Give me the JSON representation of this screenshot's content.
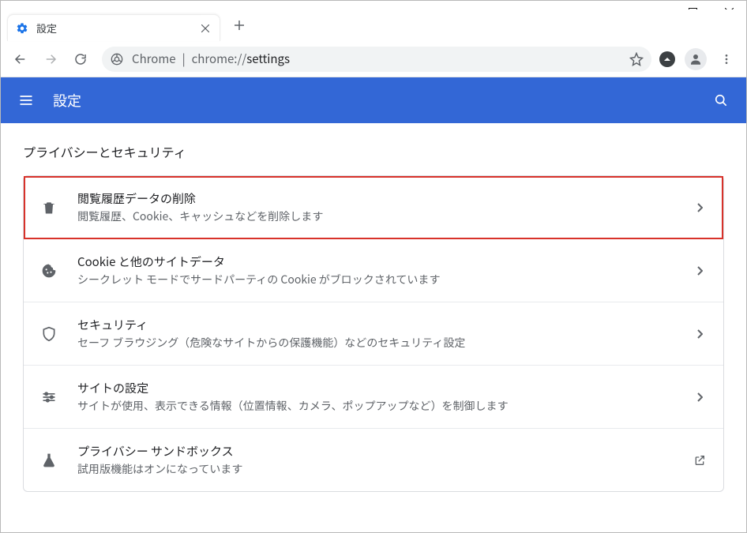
{
  "window": {
    "tab_title": "設定"
  },
  "omnibox": {
    "scheme_label": "Chrome",
    "sep": "|",
    "host": "chrome://",
    "path": "settings"
  },
  "header": {
    "title": "設定"
  },
  "section": {
    "title": "プライバシーとセキュリティ"
  },
  "rows": [
    {
      "title": "閲覧履歴データの削除",
      "sub": "閲覧履歴、Cookie、キャッシュなどを削除します"
    },
    {
      "title": "Cookie と他のサイトデータ",
      "sub": "シークレット モードでサードパーティの Cookie がブロックされています"
    },
    {
      "title": "セキュリティ",
      "sub": "セーフ ブラウジング（危険なサイトからの保護機能）などのセキュリティ設定"
    },
    {
      "title": "サイトの設定",
      "sub": "サイトが使用、表示できる情報（位置情報、カメラ、ポップアップなど）を制御します"
    },
    {
      "title": "プライバシー サンドボックス",
      "sub": "試用版機能はオンになっています"
    }
  ]
}
